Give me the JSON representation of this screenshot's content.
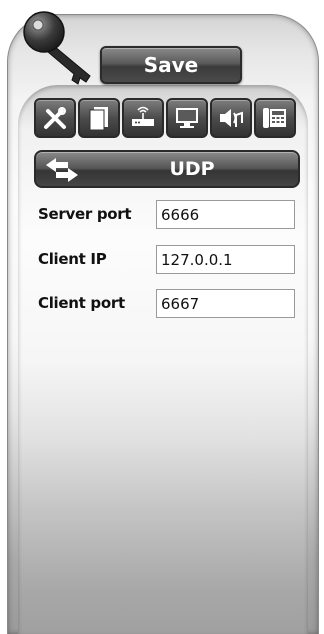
{
  "header": {
    "save_label": "Save"
  },
  "toolbar": {
    "icons": [
      "tools-icon",
      "documents-icon",
      "router-icon",
      "monitor-icon",
      "audio-icon",
      "phone-icon"
    ]
  },
  "protocol": {
    "label": "UDP",
    "icon": "bidirectional-arrow-icon"
  },
  "form": {
    "server_port": {
      "label": "Server port",
      "value": "6666"
    },
    "client_ip": {
      "label": "Client IP",
      "value": "127.0.0.1"
    },
    "client_port": {
      "label": "Client port",
      "value": "6667"
    }
  }
}
